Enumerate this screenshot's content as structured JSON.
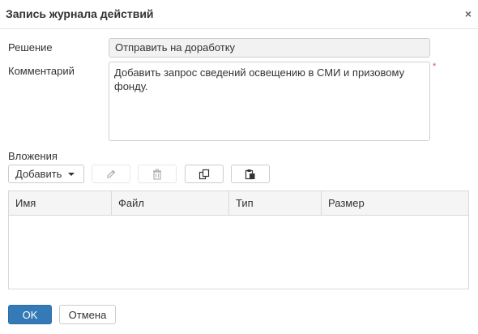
{
  "dialog": {
    "title": "Запись журнала действий",
    "close_glyph": "×"
  },
  "form": {
    "decision_label": "Решение",
    "decision_value": "Отправить на доработку",
    "comment_label": "Комментарий",
    "comment_value": "Добавить запрос сведений освещению в СМИ и призовому фонду.",
    "required_marker": "*",
    "attachments_label": "Вложения"
  },
  "toolbar": {
    "add_label": "Добавить",
    "icons": [
      "pencil-icon",
      "trash-icon",
      "copy-icon",
      "paste-icon"
    ]
  },
  "table": {
    "columns": [
      "Имя",
      "Файл",
      "Тип",
      "Размер"
    ],
    "rows": []
  },
  "footer": {
    "ok_label": "OK",
    "cancel_label": "Отмена"
  },
  "colors": {
    "primary": "#337ab7",
    "required": "#d9534f"
  }
}
